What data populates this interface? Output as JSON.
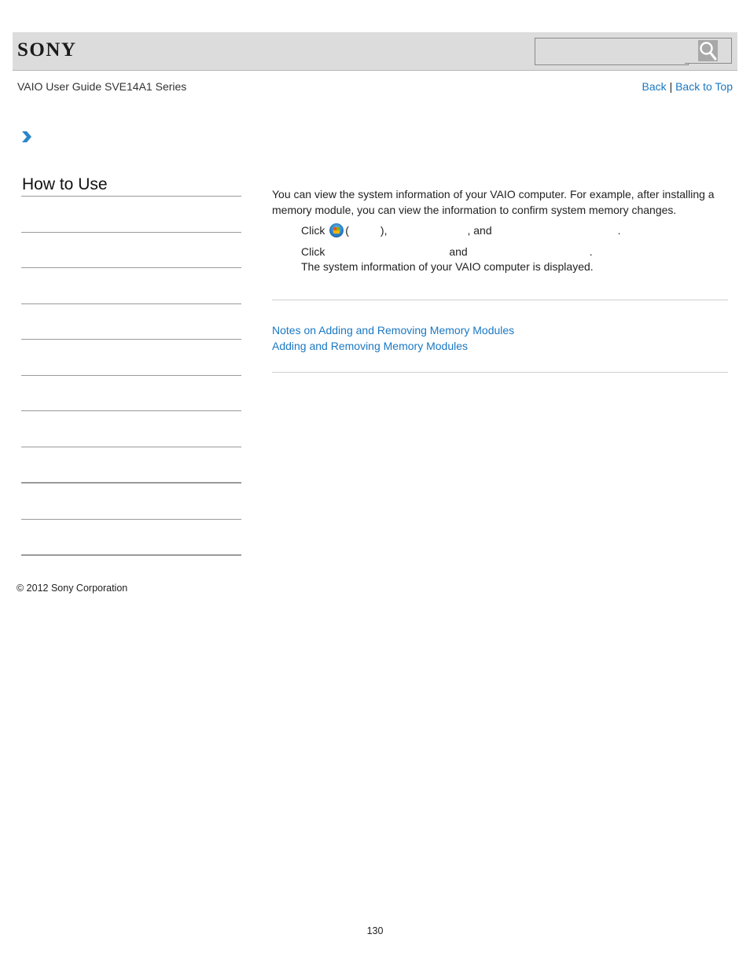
{
  "header": {
    "logo_text": "SONY",
    "search": {
      "placeholder": "",
      "value": ""
    },
    "search_icon": "magnifier-icon"
  },
  "guide_title": "VAIO User Guide SVE14A1 Series",
  "topnav": {
    "back_label": "Back",
    "separator": "|",
    "back_to_top_label": "Back to Top"
  },
  "breadcrumb_icon": "chevron-right-icon",
  "sidebar": {
    "title": "How to Use",
    "item_count": 10
  },
  "content": {
    "intro": "You can view the system information of your VAIO computer. For example, after installing a memory module, you can view the information to confirm system memory changes.",
    "step1": {
      "click": "Click",
      "open_paren": "(",
      "close_paren_comma": "),",
      "and": ", and",
      "period": "."
    },
    "step2": {
      "click": "Click",
      "and": "and",
      "period": ".",
      "result": "The system information of your VAIO computer is displayed."
    }
  },
  "related": [
    {
      "label": "Notes on Adding and Removing Memory Modules"
    },
    {
      "label": "Adding and Removing Memory Modules"
    }
  ],
  "footer": {
    "copyright": "© 2012 Sony Corporation",
    "page_number": "130"
  }
}
